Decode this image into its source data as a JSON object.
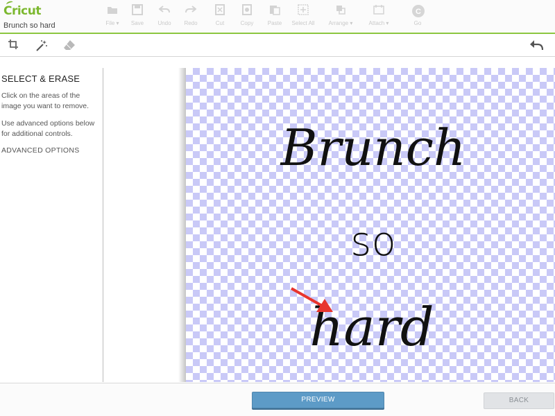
{
  "app": {
    "logo_text": "Cricut",
    "project_name": "Brunch so hard"
  },
  "toolbar": {
    "items": [
      {
        "label": "File ▾",
        "icon": "folder-icon"
      },
      {
        "label": "Save",
        "icon": "save-icon"
      },
      {
        "label": "Undo",
        "icon": "undo-icon"
      },
      {
        "label": "Redo",
        "icon": "redo-icon"
      },
      {
        "label": "Cut",
        "icon": "cut-icon"
      },
      {
        "label": "Copy",
        "icon": "copy-icon"
      },
      {
        "label": "Paste",
        "icon": "paste-icon"
      },
      {
        "label": "Select All",
        "icon": "select-all-icon"
      },
      {
        "label": "Arrange ▾",
        "icon": "arrange-icon"
      },
      {
        "label": "Attach ▾",
        "icon": "attach-icon"
      },
      {
        "label": "Go",
        "icon": "go-icon",
        "badge": "C"
      }
    ]
  },
  "subtools": {
    "items": [
      {
        "name": "crop-icon"
      },
      {
        "name": "magic-wand-icon"
      },
      {
        "name": "eraser-icon"
      }
    ],
    "undo": "undo-arrow-icon"
  },
  "panel": {
    "title": "SELECT & ERASE",
    "text1": "Click on the areas of the image you want to remove.",
    "text2": "Use advanced options below for additional controls.",
    "advanced": "ADVANCED OPTIONS"
  },
  "canvas": {
    "lines": [
      "Brunch",
      "so",
      "hard"
    ],
    "checker_color": "#c9c9f7",
    "arrow_color": "#e8352e"
  },
  "footer": {
    "preview_label": "PREVIEW",
    "back_label": "BACK"
  },
  "colors": {
    "brand": "#7cb82f",
    "primary_button": "#5d9bc7"
  }
}
